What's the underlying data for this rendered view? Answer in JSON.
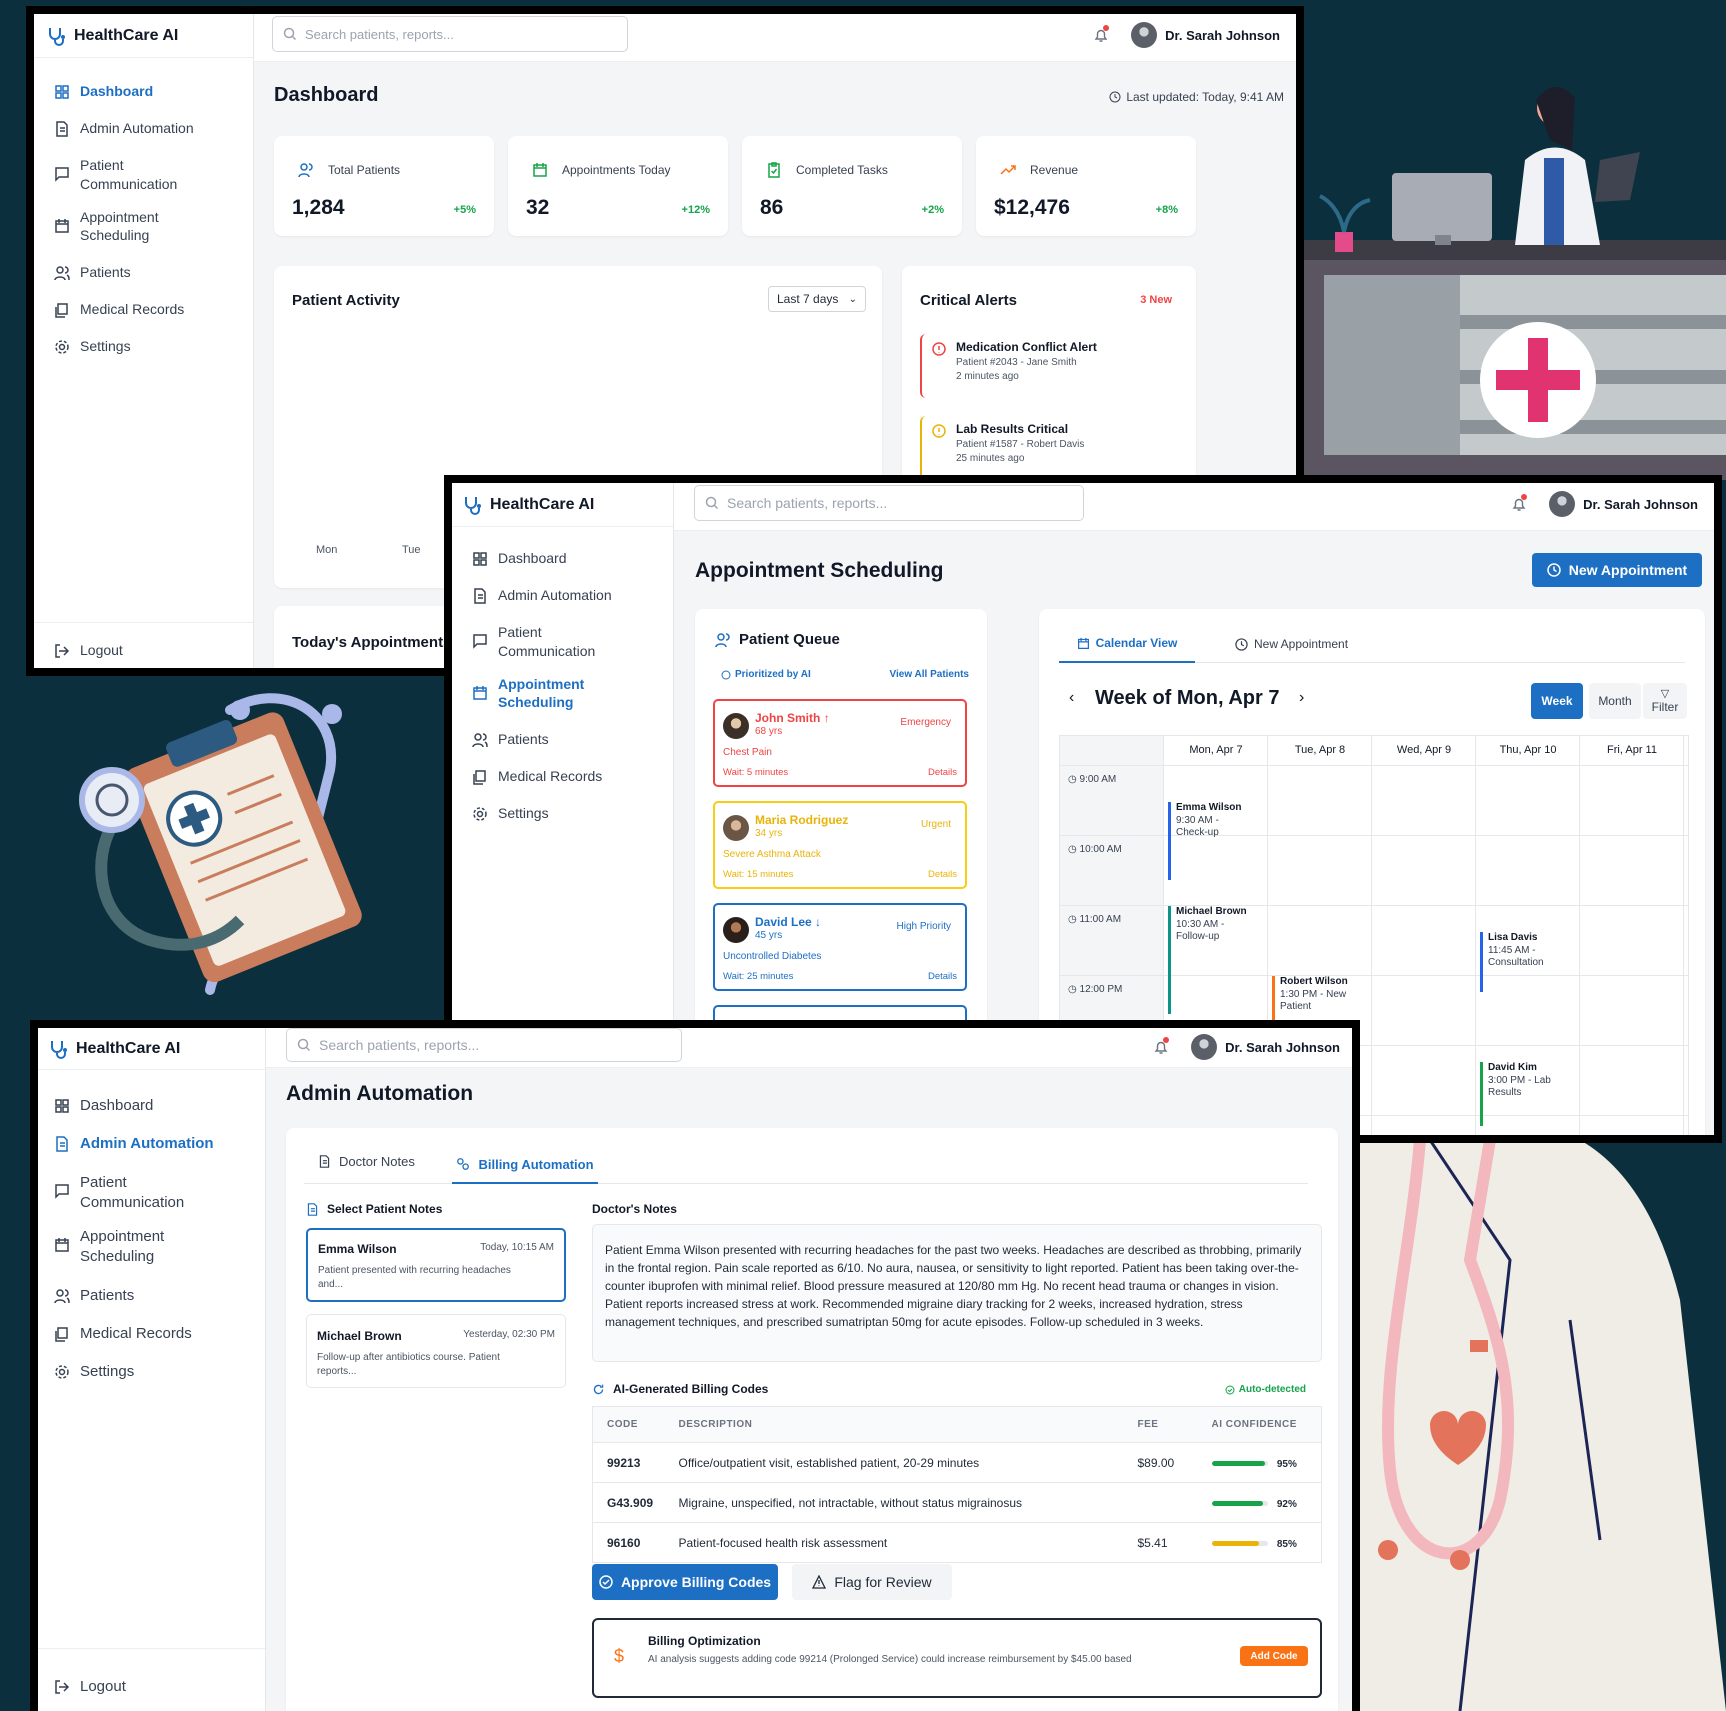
{
  "app": {
    "name": "HealthCare AI",
    "search_placeholder": "Search patients, reports...",
    "user_name": "Dr. Sarah Johnson",
    "logout": "Logout"
  },
  "nav": {
    "dashboard": "Dashboard",
    "admin": "Admin Automation",
    "comm1": "Patient",
    "comm2": "Communication",
    "appt1": "Appointment",
    "appt2": "Scheduling",
    "patients": "Patients",
    "records": "Medical Records",
    "settings": "Settings"
  },
  "dashboard": {
    "title": "Dashboard",
    "last_updated": "Last updated: Today, 9:41 AM",
    "stats": [
      {
        "label": "Total Patients",
        "value": "1,284",
        "change": "+5%"
      },
      {
        "label": "Appointments Today",
        "value": "32",
        "change": "+12%"
      },
      {
        "label": "Completed Tasks",
        "value": "86",
        "change": "+2%"
      },
      {
        "label": "Revenue",
        "value": "$12,476",
        "change": "+8%"
      }
    ],
    "activity_title": "Patient Activity",
    "range_select": "Last 7 days",
    "days": [
      "Mon",
      "Tue"
    ],
    "alerts_title": "Critical Alerts",
    "alerts_badge": "3 New",
    "alerts": [
      {
        "title": "Medication Conflict Alert",
        "patient": "Patient #2043 - Jane Smith",
        "time": "2 minutes ago"
      },
      {
        "title": "Lab Results Critical",
        "patient": "Patient #1587 - Robert Davis",
        "time": "25 minutes ago"
      }
    ],
    "today_title": "Today's Appointments"
  },
  "scheduling": {
    "title": "Appointment Scheduling",
    "new_button": "New Appointment",
    "queue_title": "Patient Queue",
    "prioritized": "Prioritized by AI",
    "view_all": "View All Patients",
    "queue": [
      {
        "name": "John Smith",
        "arrow": "↑",
        "age": "68 yrs",
        "priority": "Emergency",
        "condition": "Chest Pain",
        "wait": "Wait: 5 minutes",
        "details": "Details"
      },
      {
        "name": "Maria Rodriguez",
        "arrow": "",
        "age": "34 yrs",
        "priority": "Urgent",
        "condition": "Severe Asthma Attack",
        "wait": "Wait: 15 minutes",
        "details": "Details"
      },
      {
        "name": "David Lee",
        "arrow": "↓",
        "age": "45 yrs",
        "priority": "High Priority",
        "condition": "Uncontrolled Diabetes",
        "wait": "Wait: 25 minutes",
        "details": "Details"
      }
    ],
    "tab_calendar": "Calendar View",
    "tab_new": "New Appointment",
    "week_title": "Week of Mon, Apr 7",
    "view_week": "Week",
    "view_month": "Month",
    "filter": "Filter",
    "days": [
      "Mon, Apr 7",
      "Tue, Apr 8",
      "Wed, Apr 9",
      "Thu, Apr 10",
      "Fri, Apr 11"
    ],
    "times": [
      "9:00 AM",
      "10:00 AM",
      "11:00 AM",
      "12:00 PM"
    ],
    "events": [
      {
        "name": "Emma Wilson",
        "l1": "9:30 AM -",
        "l2": "Check-up",
        "color": "#2563eb"
      },
      {
        "name": "Michael Brown",
        "l1": "10:30 AM -",
        "l2": "Follow-up",
        "color": "#0d9488"
      },
      {
        "name": "Lisa Davis",
        "l1": "11:45 AM -",
        "l2": "Consultation",
        "color": "#2563eb"
      },
      {
        "name": "Robert Wilson",
        "l1": "1:30 PM - New",
        "l2": "Patient",
        "color": "#f97316"
      },
      {
        "name": "David Kim",
        "l1": "3:00 PM - Lab",
        "l2": "Results",
        "color": "#16a34a"
      }
    ]
  },
  "admin": {
    "title": "Admin Automation",
    "tab_notes": "Doctor Notes",
    "tab_billing": "Billing Automation",
    "select_title": "Select Patient Notes",
    "notes": [
      {
        "name": "Emma Wilson",
        "time": "Today, 10:15 AM",
        "preview1": "Patient presented with recurring headaches",
        "preview2": "and..."
      },
      {
        "name": "Michael Brown",
        "time": "Yesterday, 02:30 PM",
        "preview1": "Follow-up after antibiotics course. Patient",
        "preview2": "reports..."
      }
    ],
    "doctor_notes_title": "Doctor's Notes",
    "doctor_notes": "Patient Emma Wilson presented with recurring headaches for the past two weeks. Headaches are described as throbbing, primarily in the frontal region. Pain scale reported as 6/10. No aura, nausea, or sensitivity to light reported. Patient has been taking over-the-counter ibuprofen with minimal relief. Blood pressure measured at 120/80 mm Hg. No recent head trauma or changes in vision. Patient reports increased stress at work. Recommended migraine diary tracking for 2 weeks, increased hydration, stress management techniques, and prescribed sumatriptan 50mg for acute episodes. Follow-up scheduled in 3 weeks.",
    "codes_title": "AI-Generated Billing Codes",
    "auto_detected": "Auto-detected",
    "headers": [
      "CODE",
      "DESCRIPTION",
      "FEE",
      "AI CONFIDENCE"
    ],
    "codes": [
      {
        "code": "99213",
        "desc": "Office/outpatient visit, established patient, 20-29 minutes",
        "fee": "$89.00",
        "conf": "95%",
        "conf_val": 0.95,
        "color": "#16a34a"
      },
      {
        "code": "G43.909",
        "desc": "Migraine, unspecified, not intractable, without status migrainosus",
        "fee": "",
        "conf": "92%",
        "conf_val": 0.92,
        "color": "#16a34a"
      },
      {
        "code": "96160",
        "desc": "Patient-focused health risk assessment",
        "fee": "$5.41",
        "conf": "85%",
        "conf_val": 0.85,
        "color": "#eab308"
      }
    ],
    "approve": "Approve Billing Codes",
    "flag": "Flag for Review",
    "opt_title": "Billing Optimization",
    "opt_text": "AI analysis suggests adding code 99214 (Prolonged Service) could increase reimbursement by $45.00 based",
    "add_code": "Add Code"
  }
}
